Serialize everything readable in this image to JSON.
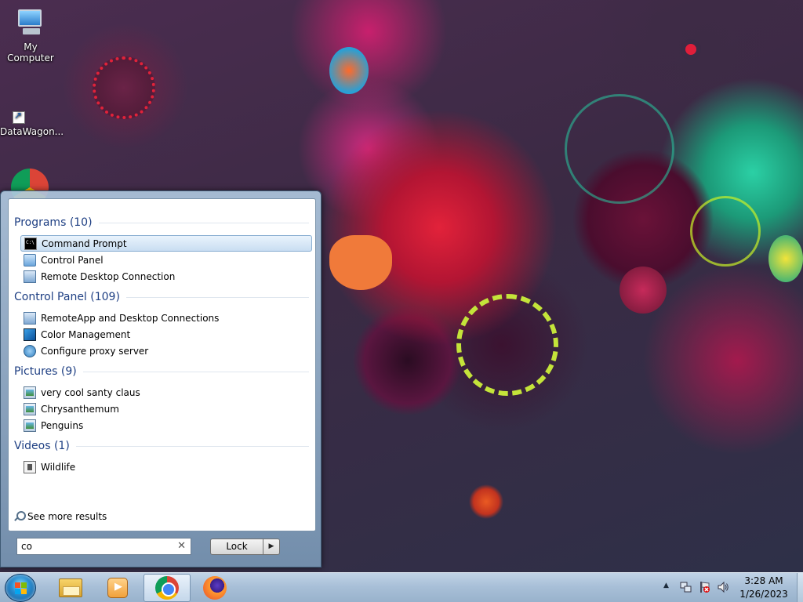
{
  "desktop": {
    "icons": [
      {
        "label": "My Computer"
      },
      {
        "label": "DataWagon..."
      }
    ]
  },
  "start_menu": {
    "groups": [
      {
        "header": "Programs (10)",
        "items": [
          {
            "label": "Command Prompt",
            "icon": "cmd-icon",
            "selected": true
          },
          {
            "label": "Control Panel",
            "icon": "control-panel-icon"
          },
          {
            "label": "Remote Desktop Connection",
            "icon": "remote-desktop-icon"
          }
        ]
      },
      {
        "header": "Control Panel (109)",
        "items": [
          {
            "label": "RemoteApp and Desktop Connections",
            "icon": "remoteapp-icon"
          },
          {
            "label": "Color Management",
            "icon": "color-management-icon"
          },
          {
            "label": "Configure proxy server",
            "icon": "proxy-server-icon"
          }
        ]
      },
      {
        "header": "Pictures (9)",
        "items": [
          {
            "label": "very cool santy claus",
            "icon": "picture-icon"
          },
          {
            "label": "Chrysanthemum",
            "icon": "picture-icon"
          },
          {
            "label": "Penguins",
            "icon": "picture-icon"
          }
        ]
      },
      {
        "header": "Videos (1)",
        "items": [
          {
            "label": "Wildlife",
            "icon": "video-icon"
          }
        ]
      }
    ],
    "see_more": "See more results",
    "search_value": "co",
    "lock_label": "Lock"
  },
  "taskbar": {
    "apps": [
      "windows-explorer-icon",
      "media-player-icon",
      "chrome-icon",
      "firefox-icon"
    ],
    "clock_time": "3:28 AM",
    "clock_date": "1/26/2023"
  }
}
